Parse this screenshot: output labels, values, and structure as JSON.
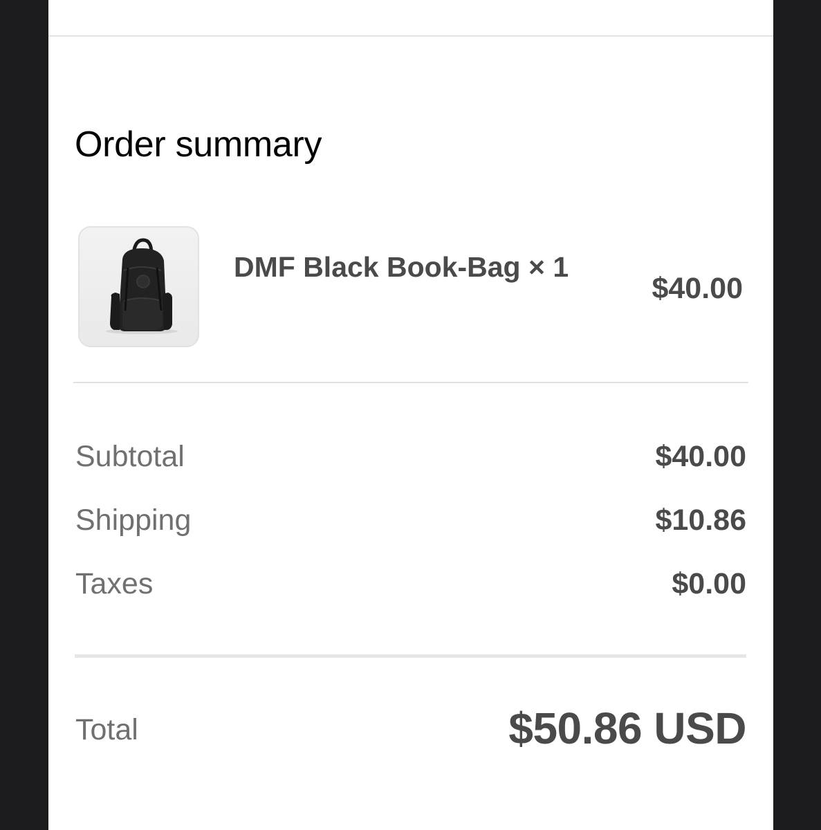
{
  "summary": {
    "heading": "Order summary"
  },
  "product": {
    "name": "DMF Black Book-Bag × 1",
    "price": "$40.00",
    "image_icon": "backpack-icon"
  },
  "totals": {
    "subtotal_label": "Subtotal",
    "subtotal_value": "$40.00",
    "shipping_label": "Shipping",
    "shipping_value": "$10.86",
    "taxes_label": "Taxes",
    "taxes_value": "$0.00",
    "total_label": "Total",
    "total_value": "$50.86 USD"
  },
  "colors": {
    "background": "#ffffff",
    "frame": "#1c1c1e",
    "value_text": "#4a4a4a",
    "label_text": "#707070"
  }
}
